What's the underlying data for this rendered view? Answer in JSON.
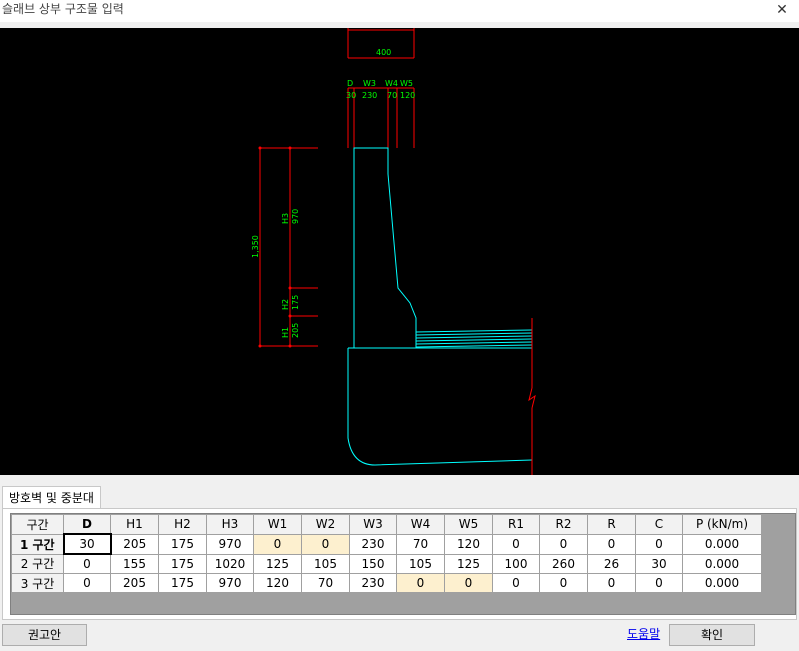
{
  "window": {
    "title": "슬래브 상부 구조물 입력"
  },
  "drawing": {
    "dimensions": {
      "top_total": "400",
      "d_label": "D",
      "d_value": "30",
      "w3_label": "W3",
      "w3_value": "230",
      "w4_label": "W4",
      "w4_value": "70",
      "w5_label": "W5",
      "w5_value": "120",
      "total_height": "1,350",
      "h3_label": "H3",
      "h3_value": "970",
      "h2_label": "H2",
      "h2_value": "175",
      "h1_label": "H1",
      "h1_value": "205"
    },
    "colors": {
      "background": "#000000",
      "dimension": "#ff0000",
      "dimension_text": "#00ff00",
      "outline": "#00ffff",
      "break_line": "#ff0000"
    }
  },
  "tabs": [
    {
      "label": "방호벽 및 중분대",
      "active": true
    }
  ],
  "table": {
    "columns": [
      "구간",
      "D",
      "H1",
      "H2",
      "H3",
      "W1",
      "W2",
      "W3",
      "W4",
      "W5",
      "R1",
      "R2",
      "R",
      "C",
      "P (kN/m)"
    ],
    "rows": [
      {
        "label": "1 구간",
        "cells": [
          "30",
          "205",
          "175",
          "970",
          "0",
          "0",
          "230",
          "70",
          "120",
          "0",
          "0",
          "0",
          "0",
          "0.000"
        ]
      },
      {
        "label": "2 구간",
        "cells": [
          "0",
          "155",
          "175",
          "1020",
          "125",
          "105",
          "150",
          "105",
          "125",
          "100",
          "260",
          "26",
          "30",
          "0.000"
        ]
      },
      {
        "label": "3 구간",
        "cells": [
          "0",
          "205",
          "175",
          "970",
          "120",
          "70",
          "230",
          "0",
          "0",
          "0",
          "0",
          "0",
          "0",
          "0.000"
        ]
      }
    ],
    "highlight_color": "#fdf0cf"
  },
  "buttons": {
    "recommend": "권고안",
    "help": "도움말",
    "ok": "확인"
  }
}
